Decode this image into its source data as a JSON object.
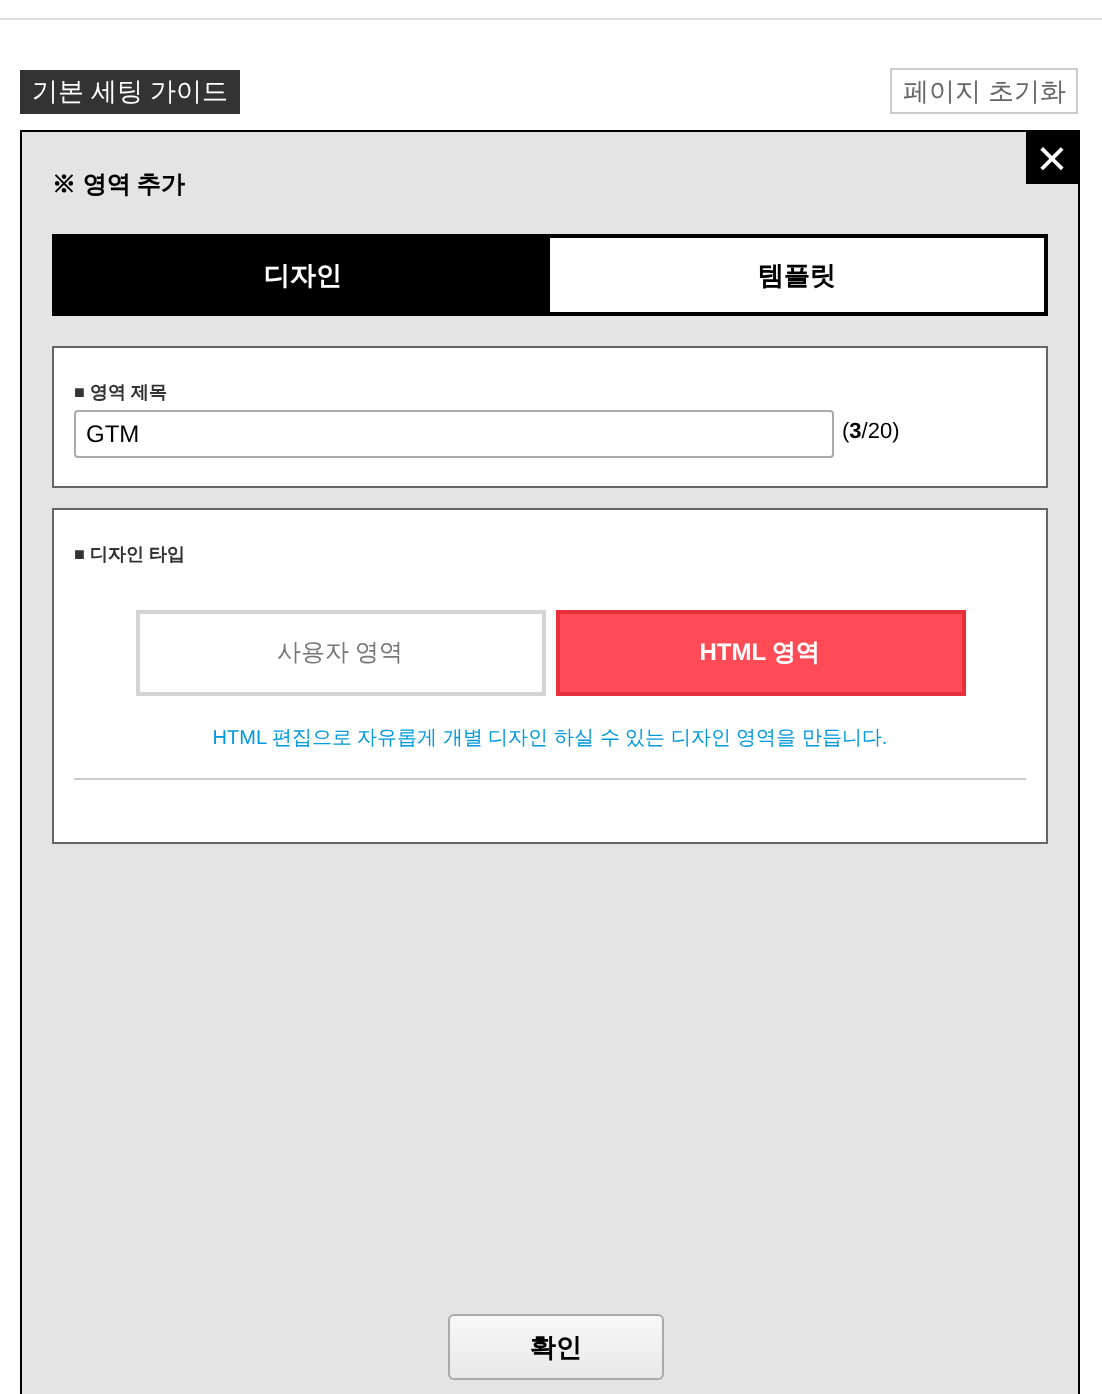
{
  "top_buttons": {
    "guide": "기본 세팅 가이드",
    "reset": "페이지 초기화"
  },
  "dialog": {
    "title": "※ 영역 추가",
    "close": "×",
    "tabs": [
      {
        "label": "디자인",
        "selected": true
      },
      {
        "label": "템플릿",
        "selected": false
      }
    ],
    "title_section": {
      "label": "■ 영역 제목",
      "value": "GTM",
      "counter": "(**3**/20)"
    },
    "type_section": {
      "label": "■ 디자인 타입",
      "options": [
        {
          "label": "사용자 영역",
          "selected": false
        },
        {
          "label": "HTML 영역",
          "selected": true
        }
      ],
      "description": "HTML 편집으로 자유롭게 개별 디자인 하실 수 있는 디자인 영역을 만듭니다."
    },
    "confirm": "확인"
  }
}
